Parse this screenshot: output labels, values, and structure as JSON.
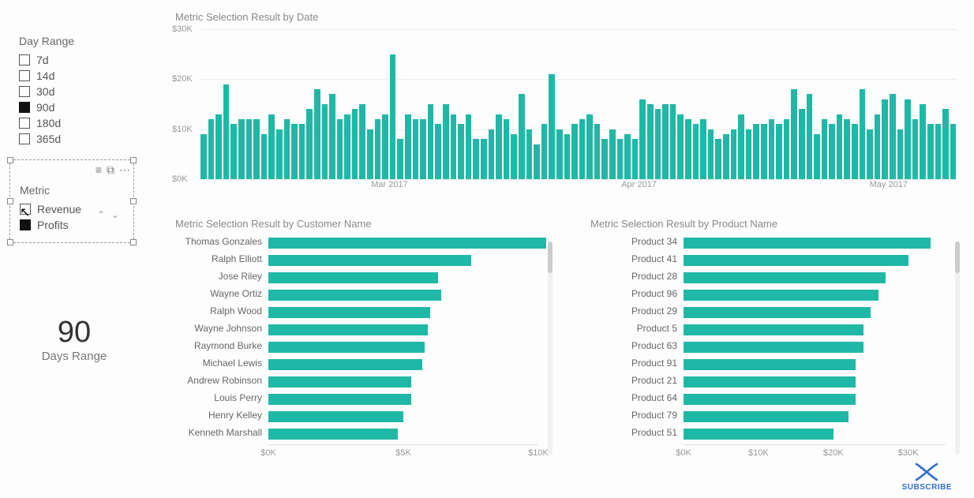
{
  "accent": "#1fb8a6",
  "day_range": {
    "title": "Day Range",
    "options": [
      {
        "label": "7d",
        "checked": false
      },
      {
        "label": "14d",
        "checked": false
      },
      {
        "label": "30d",
        "checked": false
      },
      {
        "label": "90d",
        "checked": true
      },
      {
        "label": "180d",
        "checked": false
      },
      {
        "label": "365d",
        "checked": false
      }
    ]
  },
  "metric": {
    "title": "Metric",
    "options": [
      {
        "label": "Revenue",
        "checked": false
      },
      {
        "label": "Profits",
        "checked": true
      }
    ]
  },
  "kpi": {
    "value": "90",
    "label": "Days Range"
  },
  "date_chart_title": "Metric Selection Result by Date",
  "customer_chart_title": "Metric Selection Result by Customer Name",
  "product_chart_title": "Metric Selection Result by Product Name",
  "chart_data": [
    {
      "id": "by_date",
      "type": "bar",
      "title": "Metric Selection Result by Date",
      "ylabel": "",
      "xlabel": "",
      "ylim": [
        0,
        30
      ],
      "y_ticks": [
        {
          "v": 0,
          "label": "$0K"
        },
        {
          "v": 10,
          "label": "$10K"
        },
        {
          "v": 20,
          "label": "$20K"
        },
        {
          "v": 30,
          "label": "$30K"
        }
      ],
      "x_axis_labels": [
        {
          "pos": 0.25,
          "label": "Mar 2017"
        },
        {
          "pos": 0.58,
          "label": "Apr 2017"
        },
        {
          "pos": 0.91,
          "label": "May 2017"
        }
      ],
      "values": [
        9,
        12,
        13,
        19,
        11,
        12,
        12,
        12,
        9,
        13,
        10,
        12,
        11,
        11,
        14,
        18,
        15,
        17,
        12,
        13,
        14,
        15,
        10,
        12,
        13,
        25,
        8,
        13,
        12,
        12,
        15,
        11,
        15,
        13,
        11,
        13,
        8,
        8,
        10,
        13,
        12,
        9,
        17,
        10,
        7,
        11,
        21,
        10,
        9,
        11,
        12,
        13,
        11,
        8,
        10,
        8,
        9,
        8,
        16,
        15,
        14,
        15,
        15,
        13,
        12,
        11,
        12,
        10,
        8,
        9,
        10,
        13,
        10,
        11,
        11,
        12,
        11,
        12,
        18,
        14,
        17,
        9,
        12,
        11,
        13,
        12,
        11,
        18,
        10,
        13,
        16,
        17,
        10,
        16,
        12,
        15,
        11,
        11,
        14,
        11
      ]
    },
    {
      "id": "by_customer",
      "type": "bar_h",
      "title": "Metric Selection Result by Customer Name",
      "xlabel": "",
      "ylabel": "",
      "xlim": [
        0,
        10
      ],
      "x_ticks": [
        {
          "v": 0,
          "label": "$0K"
        },
        {
          "v": 5,
          "label": "$5K"
        },
        {
          "v": 10,
          "label": "$10K"
        }
      ],
      "categories": [
        "Thomas Gonzales",
        "Ralph Elliott",
        "Jose Riley",
        "Wayne Ortiz",
        "Ralph Wood",
        "Wayne Johnson",
        "Raymond Burke",
        "Michael Lewis",
        "Andrew Robinson",
        "Louis Perry",
        "Henry Kelley",
        "Kenneth Marshall"
      ],
      "values": [
        10.3,
        7.5,
        6.3,
        6.4,
        6.0,
        5.9,
        5.8,
        5.7,
        5.3,
        5.3,
        5.0,
        4.8
      ]
    },
    {
      "id": "by_product",
      "type": "bar_h",
      "title": "Metric Selection Result by Product Name",
      "xlabel": "",
      "ylabel": "",
      "xlim": [
        0,
        35
      ],
      "x_ticks": [
        {
          "v": 0,
          "label": "$0K"
        },
        {
          "v": 10,
          "label": "$10K"
        },
        {
          "v": 20,
          "label": "$20K"
        },
        {
          "v": 30,
          "label": "$30K"
        }
      ],
      "categories": [
        "Product 34",
        "Product 41",
        "Product 28",
        "Product 96",
        "Product 29",
        "Product 5",
        "Product 63",
        "Product 91",
        "Product 21",
        "Product 64",
        "Product 79",
        "Product 51"
      ],
      "values": [
        33,
        30,
        27,
        26,
        25,
        24,
        24,
        23,
        23,
        23,
        22,
        20
      ]
    }
  ],
  "subscribe_label": "SUBSCRIBE"
}
